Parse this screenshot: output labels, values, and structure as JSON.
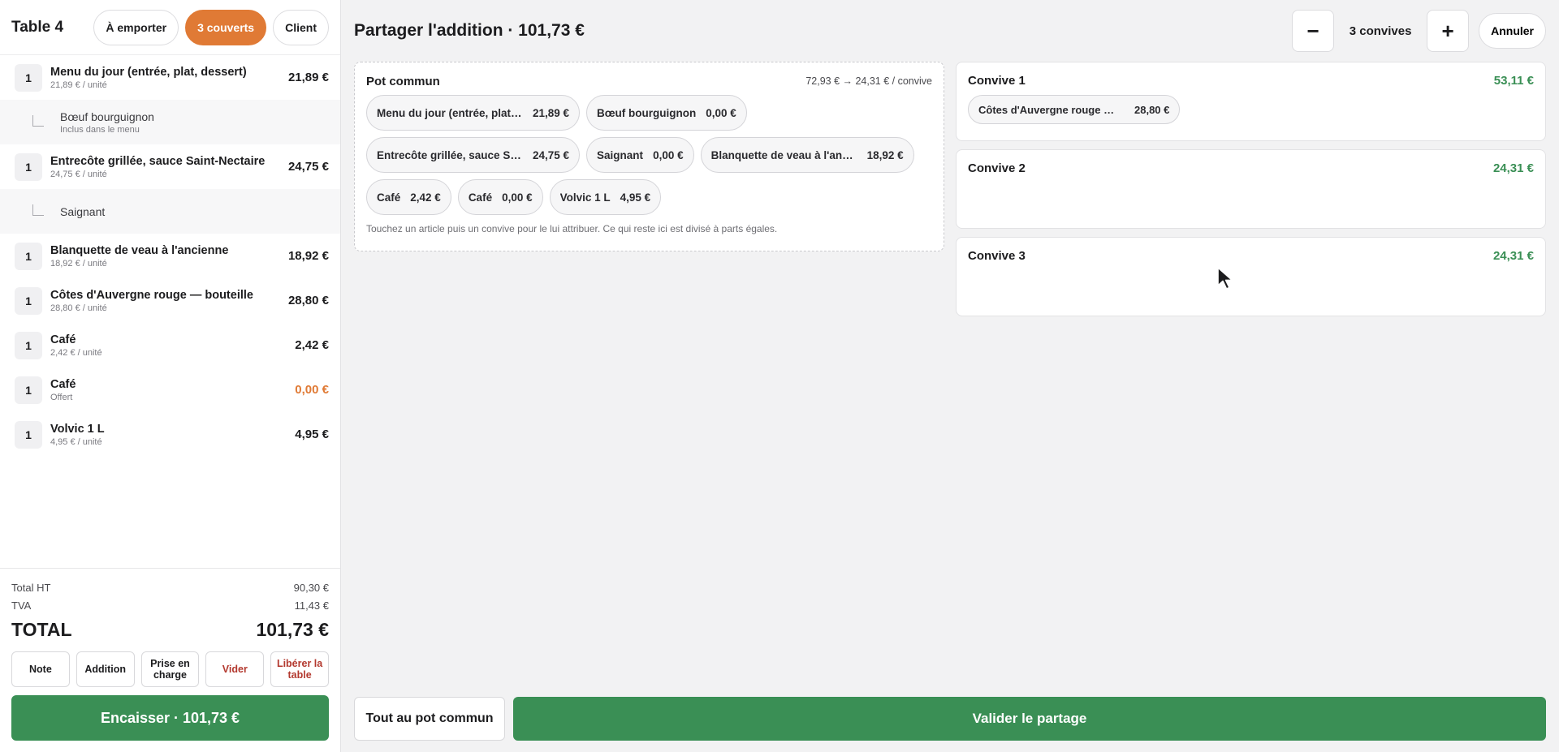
{
  "header": {
    "table_name": "Table 4",
    "takeaway_label": "À emporter",
    "covers_label": "3 couverts",
    "client_label": "Client"
  },
  "order_lines": [
    {
      "type": "item",
      "qty": "1",
      "name": "Menu du jour (entrée, plat, dessert)",
      "sub": "21,89 € / unité",
      "price": "21,89 €"
    },
    {
      "type": "modifier",
      "name": "Bœuf bourguignon",
      "sub": "Inclus dans le menu"
    },
    {
      "type": "item",
      "qty": "1",
      "name": "Entrecôte grillée, sauce Saint-Nectaire",
      "sub": "24,75 € / unité",
      "price": "24,75 €"
    },
    {
      "type": "modifier",
      "name": "Saignant",
      "sub": ""
    },
    {
      "type": "item",
      "qty": "1",
      "name": "Blanquette de veau à l'ancienne",
      "sub": "18,92 € / unité",
      "price": "18,92 €"
    },
    {
      "type": "item",
      "qty": "1",
      "name": "Côtes d'Auvergne rouge — bouteille",
      "sub": "28,80 € / unité",
      "price": "28,80 €"
    },
    {
      "type": "item",
      "qty": "1",
      "name": "Café",
      "sub": "2,42 € / unité",
      "price": "2,42 €"
    },
    {
      "type": "item",
      "qty": "1",
      "name": "Café",
      "sub": "Offert",
      "price": "0,00 €",
      "highlight": "#e07a35"
    },
    {
      "type": "item",
      "qty": "1",
      "name": "Volvic 1 L",
      "sub": "4,95 € / unité",
      "price": "4,95 €"
    }
  ],
  "totals": {
    "ht_label": "Total HT",
    "ht_value": "90,30 €",
    "tva_label": "TVA",
    "tva_value": "11,43 €",
    "total_label": "TOTAL",
    "total_value": "101,73 €"
  },
  "actions": {
    "note": "Note",
    "addition": "Addition",
    "prise": "Prise en charge",
    "vider": "Vider",
    "liberer": "Libérer la table",
    "pay": "Encaisser · 101,73 €"
  },
  "split": {
    "title": "Partager l'addition · 101,73 €",
    "minus": "−",
    "guest_count": "3 convives",
    "plus": "+",
    "cancel": "Annuler"
  },
  "pot": {
    "title": "Pot commun",
    "split_info": "72,93 € → 24,31 € / convive",
    "chips": [
      {
        "name": "Menu du jour (entrée, plat, dessert)",
        "price": "21,89 €"
      },
      {
        "name": "Bœuf bourguignon",
        "price": "0,00 €"
      },
      {
        "name": "Entrecôte grillée, sauce Saint-Nectaire",
        "price": "24,75 €"
      },
      {
        "name": "Saignant",
        "price": "0,00 €"
      },
      {
        "name": "Blanquette de veau à l'ancienne",
        "price": "18,92 €"
      },
      {
        "name": "Café",
        "price": "2,42 €"
      },
      {
        "name": "Café",
        "price": "0,00 €"
      },
      {
        "name": "Volvic 1 L",
        "price": "4,95 €"
      }
    ],
    "hint": "Touchez un article puis un convive pour le lui attribuer. Ce qui reste ici est divisé à parts égales."
  },
  "guests": [
    {
      "name": "Convive 1",
      "amount": "53,11 €",
      "chips": [
        {
          "name": "Côtes d'Auvergne rouge — bouteille",
          "price": "28,80 €"
        }
      ]
    },
    {
      "name": "Convive 2",
      "amount": "24,31 €",
      "chips": []
    },
    {
      "name": "Convive 3",
      "amount": "24,31 €",
      "chips": []
    }
  ],
  "footer": {
    "all_pot": "Tout au pot commun",
    "validate": "Valider le partage"
  },
  "colors": {
    "accent": "#e07a35",
    "success": "#3a8f55",
    "danger": "#b3392f"
  }
}
